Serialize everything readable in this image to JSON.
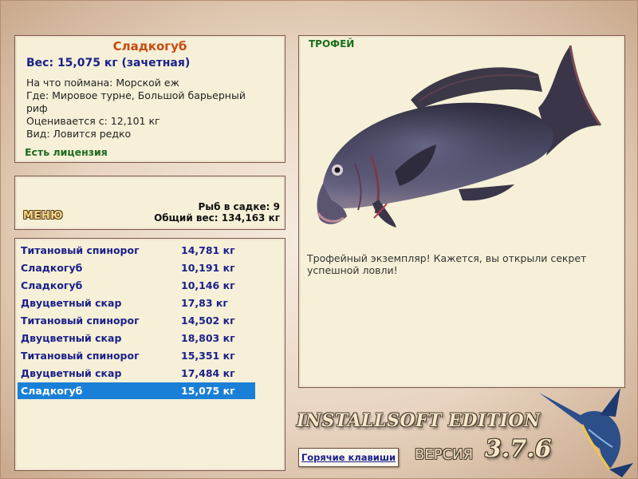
{
  "fish": {
    "name": "Сладкогуб",
    "weight_line": "Вес: 15,075 кг (зачетная)",
    "caught_with": "На что поймана: Морской еж",
    "location": "Где: Мировое турне, Большой барьерный риф",
    "rated_from": "Оценивается с: 12,101 кг",
    "species": "Вид: Ловится редко",
    "license": "Есть лицензия"
  },
  "menu": {
    "button_label": "МЕНЮ",
    "fish_in_cage": "Рыб в садке: 9",
    "total_weight": "Общий вес: 134,163 кг"
  },
  "catch_list": [
    {
      "name": "Титановый спинорог",
      "weight": "14,781 кг"
    },
    {
      "name": "Сладкогуб",
      "weight": "10,191 кг"
    },
    {
      "name": "Сладкогуб",
      "weight": "10,146 кг"
    },
    {
      "name": "Двуцветный скар",
      "weight": "17,83 кг"
    },
    {
      "name": "Титановый спинорог",
      "weight": "14,502 кг"
    },
    {
      "name": "Двуцветный скар",
      "weight": "18,803 кг"
    },
    {
      "name": "Титановый спинорог",
      "weight": "15,351 кг"
    },
    {
      "name": "Двуцветный скар",
      "weight": "17,484 кг"
    },
    {
      "name": "Сладкогуб",
      "weight": "15,075 кг"
    }
  ],
  "selected_index": 8,
  "trophy": {
    "tag": "ТРОФЕЙ",
    "description": "Трофейный экземпляр! Кажется, вы открыли секрет успешной ловли!"
  },
  "branding": {
    "edition": "INSTALLSOFT EDITION",
    "version_label": "ВЕРСИЯ",
    "version_number": "3.7.6",
    "hotkeys_label": "Горячие клавиши"
  },
  "colors": {
    "panel_bg": "#f5f0d7",
    "title_orange": "#c84a12",
    "text_blue": "#1a1f8a",
    "license_green": "#1e6a1e",
    "selection_blue": "#1a7fd6"
  }
}
